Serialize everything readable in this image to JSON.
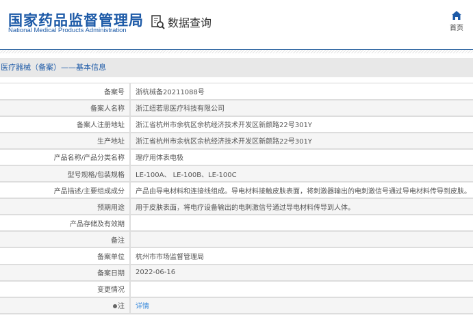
{
  "header": {
    "logo_cn": "国家药品监督管理局",
    "logo_en": "National Medical Products Administration",
    "query_label": "数据查询",
    "home_label": "首页"
  },
  "section_title": "医疗器械（备案）——基本信息",
  "rows": [
    {
      "label": "备案号",
      "value": "浙杭械备20211088号"
    },
    {
      "label": "备案人名称",
      "value": "浙江纽若思医疗科技有限公司"
    },
    {
      "label": "备案人注册地址",
      "value": "浙江省杭州市余杭区余杭经济技术开发区新颜路22号301Y"
    },
    {
      "label": "生产地址",
      "value": "浙江省杭州市余杭区余杭经济技术开发区新颜路22号301Y"
    },
    {
      "label": "产品名称/产品分类名称",
      "value": "理疗用体表电极"
    },
    {
      "label": "型号规格/包装规格",
      "value": "LE-100A、 LE-100B、LE-100C"
    },
    {
      "label": "产品描述/主要组成成分",
      "value": "产品由导电材料和连接线组成。导电材料接触皮肤表面，将刺激器输出的电刺激信号通过导电材料传导到皮肤。"
    },
    {
      "label": "预期用途",
      "value": "用于皮肤表面，将电疗设备输出的电刺激信号通过导电材料传导到人体。"
    },
    {
      "label": "产品存储及有效期",
      "value": ""
    },
    {
      "label": "备注",
      "value": ""
    },
    {
      "label": "备案单位",
      "value": "杭州市市场监督管理局"
    },
    {
      "label": "备案日期",
      "value": "2022-06-16"
    },
    {
      "label": "变更情况",
      "value": ""
    },
    {
      "label": "注",
      "value": "详情"
    }
  ],
  "colors": {
    "brand": "#1d5aa7",
    "link": "#3b8bdc"
  }
}
